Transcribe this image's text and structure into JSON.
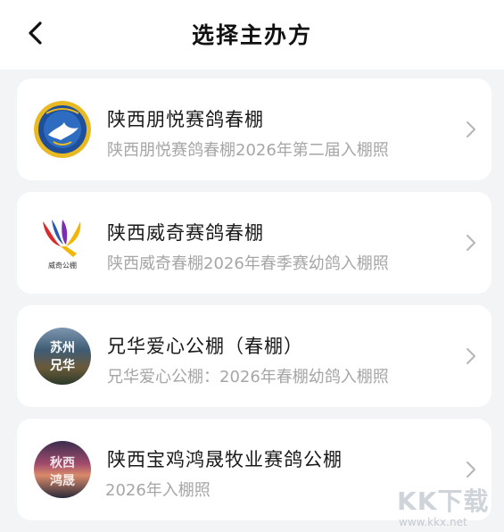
{
  "header": {
    "title": "选择主办方",
    "back_icon": "chevron-left-icon"
  },
  "organizers": [
    {
      "name": "陕西朋悦赛鸽春棚",
      "subtitle": "陕西朋悦赛鸽春棚2026年第二届入棚照"
    },
    {
      "name": "陕西威奇赛鸽春棚",
      "subtitle": "陕西威奇春棚2026年春季赛幼鸽入棚照",
      "logo_text": "威奇公棚"
    },
    {
      "name": "兄华爱心公棚（春棚）",
      "subtitle": "兄华爱心公棚：2026年春棚幼鸽入棚照",
      "logo_text": [
        "苏州",
        "兄华"
      ]
    },
    {
      "name": "陕西宝鸡鸿晟牧业赛鸽公棚",
      "subtitle": "2026年入棚照",
      "logo_text": [
        "秋西",
        "鸿晟"
      ]
    }
  ],
  "watermark": {
    "text": "KK下载",
    "url": "www.kkx.net"
  },
  "colors": {
    "background": "#f3f4f6",
    "card": "#ffffff",
    "title": "#1a1a1a",
    "subtitle": "#a6a6a6",
    "chevron": "#b5b5b5"
  }
}
